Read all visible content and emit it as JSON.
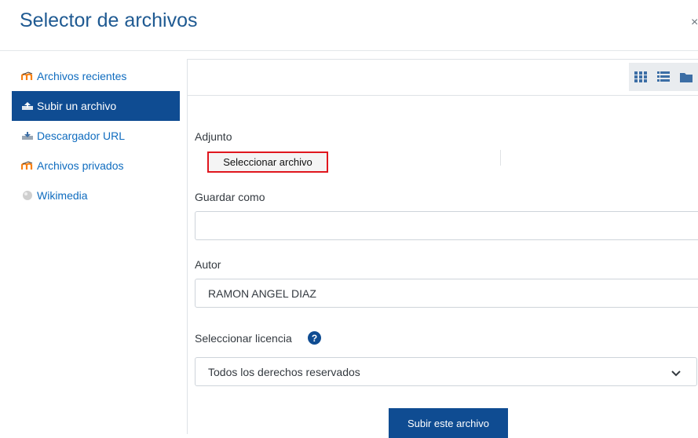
{
  "dialog": {
    "title": "Selector de archivos",
    "close_label": "×"
  },
  "sidebar": {
    "items": [
      {
        "label": "Archivos recientes",
        "icon": "moodle-icon",
        "active": false
      },
      {
        "label": "Subir un archivo",
        "icon": "upload-icon",
        "active": true
      },
      {
        "label": "Descargador URL",
        "icon": "download-url-icon",
        "active": false
      },
      {
        "label": "Archivos privados",
        "icon": "moodle-icon",
        "active": false
      },
      {
        "label": "Wikimedia",
        "icon": "wikimedia-icon",
        "active": false
      }
    ]
  },
  "toolbar": {
    "views": [
      "grid-view-icon",
      "list-view-icon",
      "folder-view-icon"
    ]
  },
  "form": {
    "attachment_label": "Adjunto",
    "select_file_label": "Seleccionar archivo",
    "save_as_label": "Guardar como",
    "save_as_value": "",
    "author_label": "Autor",
    "author_value": "RAMON ANGEL DIAZ",
    "license_label": "Seleccionar licencia",
    "license_value": "Todos los derechos reservados",
    "submit_label": "Subir este archivo"
  },
  "colors": {
    "title": "#1f5a92",
    "active_bg": "#0f4c92",
    "link": "#0f6cbf",
    "highlight_border": "#e0161e"
  }
}
